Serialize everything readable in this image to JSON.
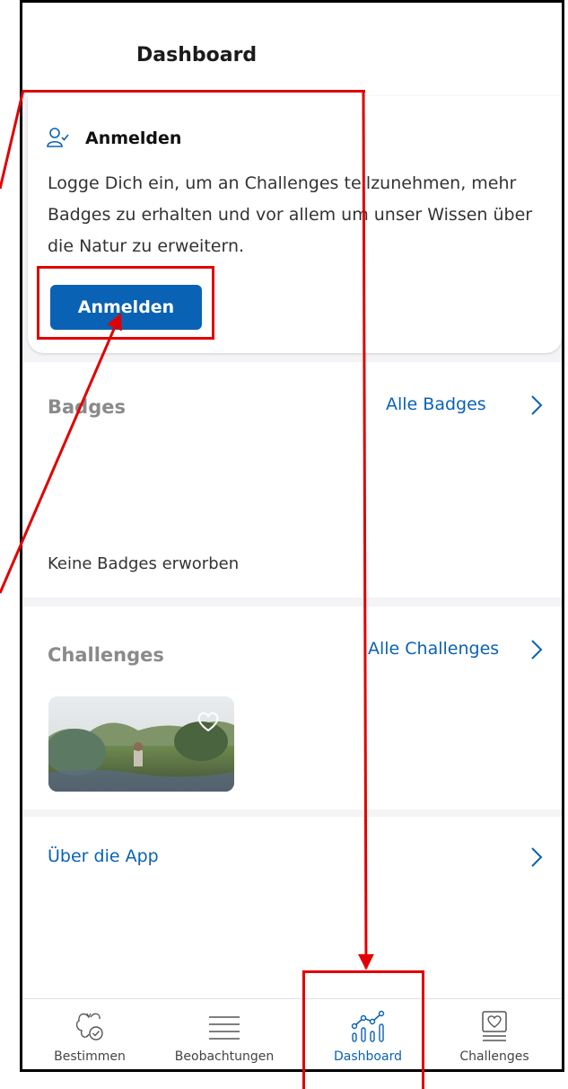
{
  "header": {
    "title": "Dashboard"
  },
  "login_card": {
    "heading": "Anmelden",
    "description": "Logge Dich ein, um an Challenges teilzunehmen, mehr Badges zu erhalten und vor allem um unser Wissen über die Natur zu erweitern.",
    "button_label": "Anmelden",
    "icon": "user-check-icon"
  },
  "badges": {
    "heading": "Badges",
    "all_link": "Alle Badges",
    "empty_text": "Keine Badges erworben"
  },
  "challenges": {
    "heading": "Challenges",
    "all_link": "Alle Challenges"
  },
  "about": {
    "link": "Über die App"
  },
  "bottom_nav": {
    "items": [
      {
        "label": "Bestimmen",
        "icon": "butterfly-check-icon"
      },
      {
        "label": "Beobachtungen",
        "icon": "list-icon"
      },
      {
        "label": "Dashboard",
        "icon": "chart-icon",
        "active": true
      },
      {
        "label": "Challenges",
        "icon": "heart-card-icon"
      }
    ]
  },
  "colors": {
    "accent": "#0a62b4",
    "annotation": "#e00000"
  }
}
